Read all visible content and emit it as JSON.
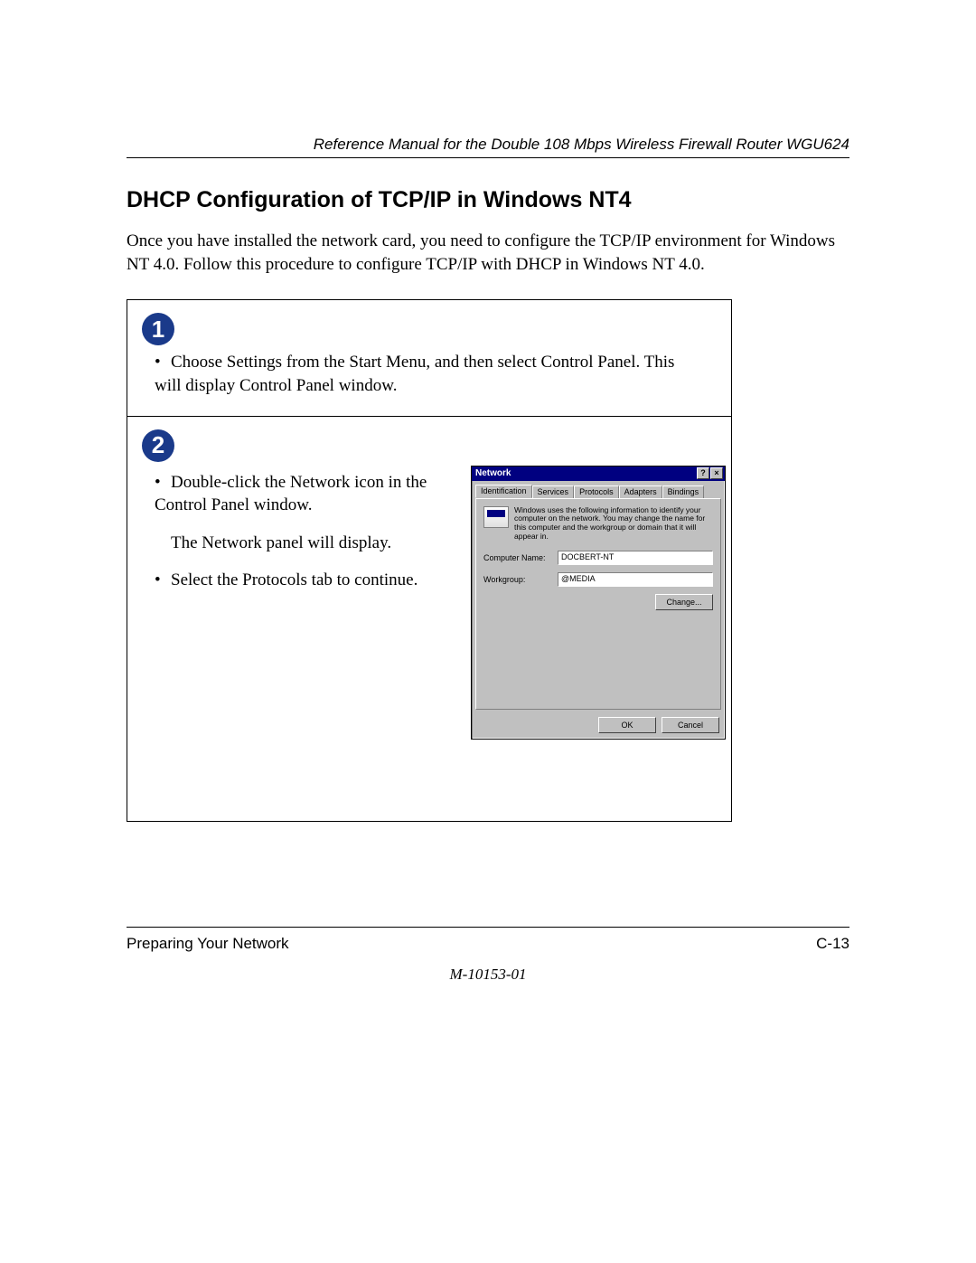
{
  "header": {
    "reference_line": "Reference Manual for the Double 108 Mbps Wireless Firewall Router WGU624"
  },
  "section": {
    "title": "DHCP Configuration of TCP/IP in Windows NT4",
    "intro": "Once you have installed the network card, you need to configure the TCP/IP environment for Windows NT 4.0. Follow this procedure to configure TCP/IP with DHCP in Windows NT 4.0."
  },
  "step1": {
    "badge": "1",
    "line1": "Choose Settings from the Start Menu, and then select Control Panel. This will display Control Panel window."
  },
  "step2": {
    "badge": "2",
    "bullet1": "Double-click the Network icon in the Control Panel window.",
    "plain": "The Network panel will display.",
    "bullet2": "Select the Protocols tab to continue."
  },
  "dialog": {
    "title": "Network",
    "help_btn": "?",
    "close_btn": "×",
    "tabs": {
      "identification": "Identification",
      "services": "Services",
      "protocols": "Protocols",
      "adapters": "Adapters",
      "bindings": "Bindings"
    },
    "description": "Windows uses the following information to identify your computer on the network. You may change the name for this computer and the workgroup or domain that it will appear in.",
    "computer_name_label": "Computer Name:",
    "computer_name_value": "DOCBERT-NT",
    "workgroup_label": "Workgroup:",
    "workgroup_value": "@MEDIA",
    "change_button": "Change...",
    "ok_button": "OK",
    "cancel_button": "Cancel"
  },
  "footer": {
    "section_name": "Preparing Your Network",
    "page_number": "C-13",
    "doc_number": "M-10153-01"
  }
}
